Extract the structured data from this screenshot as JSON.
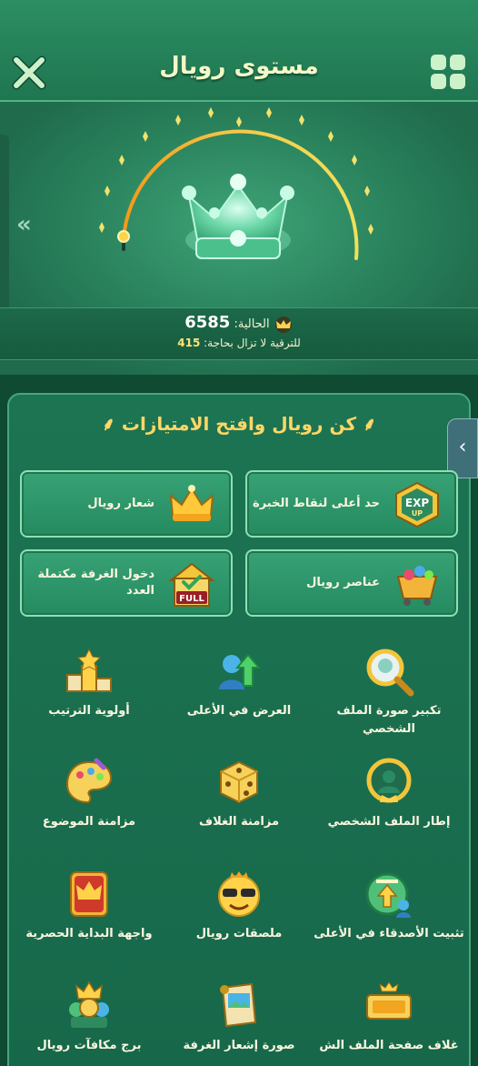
{
  "header": {
    "title": "مستوى رويال",
    "close_icon": "close-icon",
    "menu_icon": "grid-menu-icon"
  },
  "hero": {
    "current_label": "الحالية:",
    "current_value": "6585",
    "upgrade_label": "للترقية لا تزال بحاجة:",
    "upgrade_value": "415",
    "progress_fraction": 0.0
  },
  "panel": {
    "title": "كن رويال وافتح الامتيازات"
  },
  "feature_cards": [
    {
      "label": "حد أعلى لنقاط الخبرة",
      "icon": "exp-up-icon"
    },
    {
      "label": "شعار رويال",
      "icon": "crown-badge-icon"
    },
    {
      "label": "عناصر رويال",
      "icon": "cart-icon"
    },
    {
      "label": "دخول الغرفة مكتملة العدد",
      "icon": "full-room-icon"
    }
  ],
  "privileges": [
    {
      "label": "تكبير صورة الملف الشخصي",
      "icon": "magnify-avatar-icon"
    },
    {
      "label": "العرض في الأعلى",
      "icon": "show-top-icon"
    },
    {
      "label": "أولوية الترتيب",
      "icon": "podium-icon"
    },
    {
      "label": "إطار الملف الشخصي",
      "icon": "profile-frame-icon"
    },
    {
      "label": "مزامنة الغلاف",
      "icon": "dice-icon"
    },
    {
      "label": "مزامنة الموضوع",
      "icon": "palette-icon"
    },
    {
      "label": "تثبيت الأصدقاء في الأعلى",
      "icon": "pin-friends-icon"
    },
    {
      "label": "ملصقات رويال",
      "icon": "emoji-sticker-icon"
    },
    {
      "label": "واجهة البداية الحصرية",
      "icon": "crown-card-icon"
    },
    {
      "label": "غلاف صفحة الملف الش",
      "icon": "cover-banner-icon"
    },
    {
      "label": "صورة إشعار الغرفة",
      "icon": "scroll-notice-icon"
    },
    {
      "label": "برج مكافآت رويال",
      "icon": "reward-tower-icon"
    }
  ],
  "colors": {
    "accent_gold": "#ffd766",
    "panel_green": "#1c7452",
    "progress_orange": "#f29a1a"
  }
}
